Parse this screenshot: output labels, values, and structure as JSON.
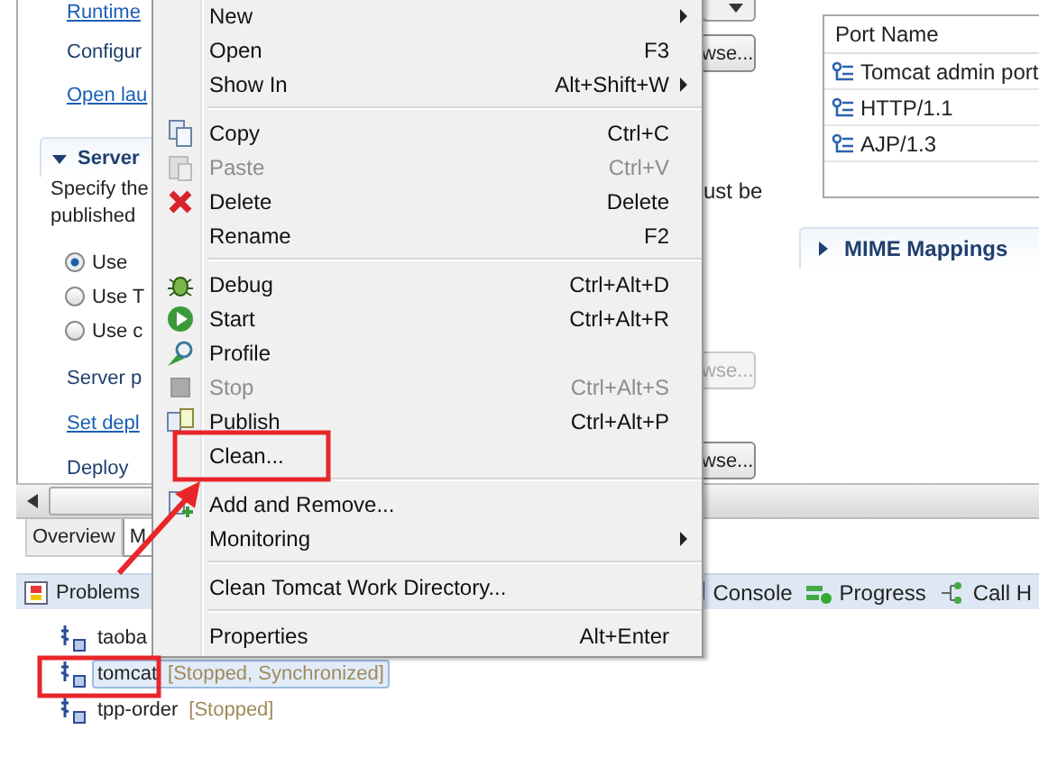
{
  "overview": {
    "runtime_link": "Runtime",
    "configure_text": "Configur",
    "open_launch_link": "Open lau",
    "server_locations": {
      "title": "Server",
      "expanded": true,
      "description": [
        "Specify the",
        "published"
      ],
      "description_end": "ust be",
      "options": [
        {
          "label": "Use",
          "selected": true
        },
        {
          "label": "Use T",
          "selected": false
        },
        {
          "label": "Use c",
          "selected": false
        }
      ],
      "server_path_label": "Server p",
      "set_deploy_link": "Set depl",
      "deploy_path_label": "Deploy"
    },
    "browse_buttons": [
      {
        "label": "wse...",
        "disabled": false
      },
      {
        "label": "wse...",
        "disabled": true
      },
      {
        "label": "wse...",
        "disabled": false
      }
    ],
    "ports_table": {
      "column": "Port Name",
      "rows": [
        "Tomcat admin port",
        "HTTP/1.1",
        "AJP/1.3"
      ]
    },
    "mime_mappings": {
      "title": "MIME Mappings",
      "expanded": false
    }
  },
  "editor_tabs": [
    {
      "label": "Overview",
      "selected": false
    },
    {
      "label": "M",
      "selected": true
    }
  ],
  "views": {
    "problems": "Problems",
    "right": [
      "Console",
      "Progress",
      "Call H"
    ]
  },
  "servers": [
    {
      "name": "taoba",
      "selected": false
    },
    {
      "name": "tomcat",
      "status": "[Stopped, Synchronized]",
      "selected": true
    },
    {
      "name": "tpp-order",
      "status": "[Stopped]",
      "selected": false
    }
  ],
  "menu": [
    {
      "items": [
        {
          "label": "New",
          "disabled": false,
          "submenu": true
        },
        {
          "label": "Open",
          "shortcut": "F3",
          "disabled": false,
          "submenu": false
        },
        {
          "label": "Show In",
          "shortcut": "Alt+Shift+W",
          "disabled": false,
          "submenu": true
        }
      ]
    },
    {
      "items": [
        {
          "label": "Copy",
          "shortcut": "Ctrl+C",
          "disabled": false,
          "submenu": false
        },
        {
          "label": "Paste",
          "shortcut": "Ctrl+V",
          "disabled": true,
          "submenu": false
        },
        {
          "label": "Delete",
          "shortcut": "Delete",
          "disabled": false,
          "submenu": false
        },
        {
          "label": "Rename",
          "shortcut": "F2",
          "disabled": false,
          "submenu": false
        }
      ]
    },
    {
      "items": [
        {
          "label": "Debug",
          "shortcut": "Ctrl+Alt+D",
          "disabled": false,
          "submenu": false
        },
        {
          "label": "Start",
          "shortcut": "Ctrl+Alt+R",
          "disabled": false,
          "submenu": false
        },
        {
          "label": "Profile",
          "disabled": false,
          "submenu": false
        },
        {
          "label": "Stop",
          "shortcut": "Ctrl+Alt+S",
          "disabled": true,
          "submenu": false
        },
        {
          "label": "Publish",
          "shortcut": "Ctrl+Alt+P",
          "disabled": false,
          "submenu": false
        },
        {
          "label": "Clean...",
          "disabled": false,
          "submenu": false
        }
      ]
    },
    {
      "items": [
        {
          "label": "Add and Remove...",
          "disabled": false,
          "submenu": false
        },
        {
          "label": "Monitoring",
          "disabled": false,
          "submenu": true
        }
      ]
    },
    {
      "items": [
        {
          "label": "Clean Tomcat Work Directory...",
          "disabled": false,
          "submenu": false
        }
      ]
    },
    {
      "items": [
        {
          "label": "Properties",
          "shortcut": "Alt+Enter",
          "disabled": false,
          "submenu": false
        }
      ]
    }
  ]
}
